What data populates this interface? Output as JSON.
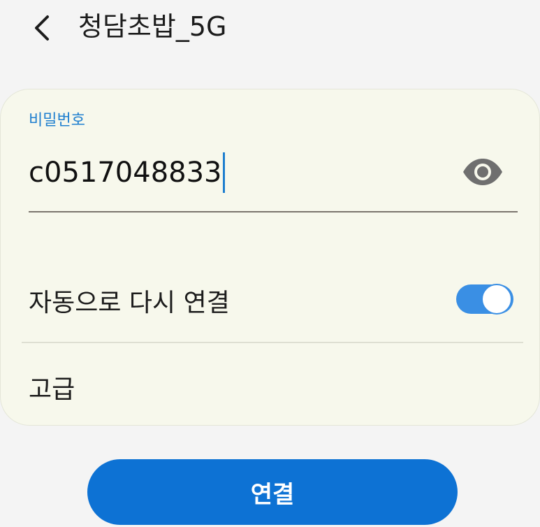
{
  "header": {
    "title": "청담초밥_5G",
    "back_icon": "chevron-left-icon"
  },
  "password": {
    "label": "비밀번호",
    "value": "c0517048833",
    "visibility_icon": "eye-icon"
  },
  "settings": {
    "auto_reconnect": {
      "label": "자동으로 다시 연결",
      "enabled": true
    },
    "advanced": {
      "label": "고급"
    }
  },
  "actions": {
    "connect_label": "연결"
  },
  "colors": {
    "accent": "#1f7fcf",
    "button": "#0d72d4",
    "card": "#f7f8ec",
    "background": "#f4f4f4"
  }
}
